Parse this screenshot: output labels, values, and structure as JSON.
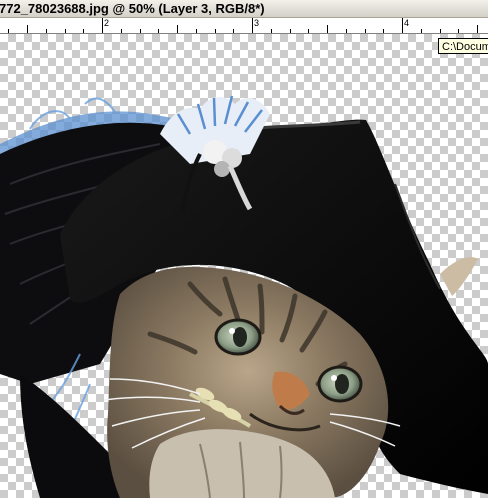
{
  "window": {
    "title": "772_78023688.jpg @ 50% (Layer 3, RGB/8*)"
  },
  "ruler": {
    "labels": [
      "2",
      "3",
      "4"
    ]
  },
  "tooltip": {
    "text": "C:\\Docume"
  },
  "canvas": {
    "transparency_grid": "checkerboard",
    "image_subject": "tabby-kitten-with-plumed-hat"
  }
}
